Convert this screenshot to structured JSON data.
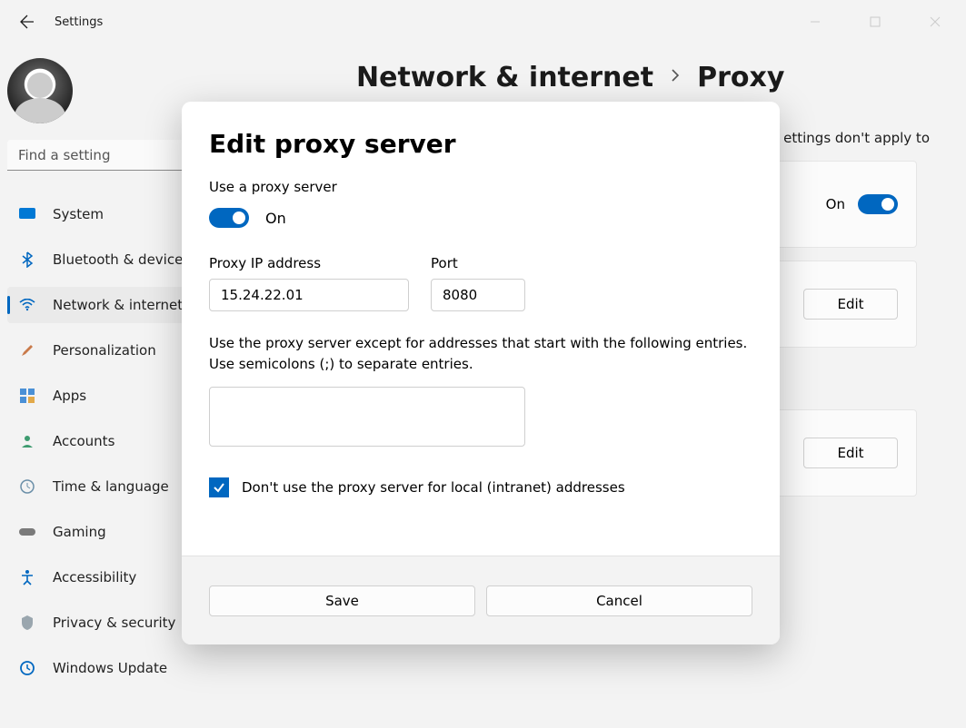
{
  "titlebar": {
    "title": "Settings"
  },
  "search": {
    "placeholder": "Find a setting"
  },
  "sidebar": {
    "items": [
      {
        "label": "System"
      },
      {
        "label": "Bluetooth & devices"
      },
      {
        "label": "Network & internet"
      },
      {
        "label": "Personalization"
      },
      {
        "label": "Apps"
      },
      {
        "label": "Accounts"
      },
      {
        "label": "Time & language"
      },
      {
        "label": "Gaming"
      },
      {
        "label": "Accessibility"
      },
      {
        "label": "Privacy & security"
      },
      {
        "label": "Windows Update"
      }
    ]
  },
  "breadcrumb": {
    "parent": "Network & internet",
    "current": "Proxy"
  },
  "page": {
    "description_fragment": "ettings don't apply to",
    "card1": {
      "toggle_label": "On"
    },
    "card2": {
      "button": "Edit"
    },
    "card3": {
      "button": "Edit"
    }
  },
  "dialog": {
    "title": "Edit proxy server",
    "use_label": "Use a proxy server",
    "toggle_label": "On",
    "ip_label": "Proxy IP address",
    "ip_value": "15.24.22.01",
    "port_label": "Port",
    "port_value": "8080",
    "exceptions_label": "Use the proxy server except for addresses that start with the following entries. Use semicolons (;) to separate entries.",
    "local_checkbox_label": "Don't use the proxy server for local (intranet) addresses",
    "save": "Save",
    "cancel": "Cancel"
  }
}
